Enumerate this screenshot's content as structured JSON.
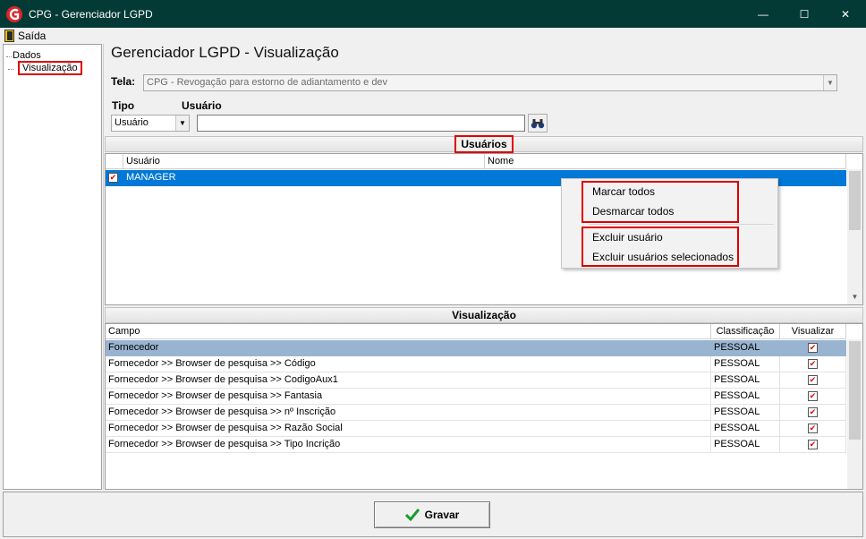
{
  "window": {
    "title": "CPG - Gerenciador LGPD",
    "controls": [
      "—",
      "☐",
      "✕"
    ]
  },
  "menu": {
    "exit_label": "Saída"
  },
  "tree": {
    "items": [
      {
        "label": "Dados"
      },
      {
        "label": "Visualização"
      }
    ]
  },
  "page": {
    "title": "Gerenciador LGPD - Visualização"
  },
  "form": {
    "screen_label": "Tela:",
    "screen_value": "CPG - Revogação para estorno de adiantamento e dev",
    "type_label": "Tipo",
    "type_value": "Usuário",
    "user_label": "Usuário",
    "user_value": ""
  },
  "users": {
    "header": "Usuários",
    "columns": [
      "Usuário",
      "Nome"
    ],
    "rows": [
      {
        "checked": true,
        "user": "MANAGER",
        "name": ""
      }
    ]
  },
  "context_menu": {
    "items": [
      "Marcar todos",
      "Desmarcar todos",
      "Excluir usuário",
      "Excluir usuários selecionados"
    ]
  },
  "view": {
    "header": "Visualização",
    "columns": [
      "Campo",
      "Classificação",
      "Visualizar"
    ],
    "rows": [
      {
        "field": "Fornecedor",
        "class": "PESSOAL",
        "checked": true
      },
      {
        "field": "Fornecedor >> Browser de pesquisa >> Código",
        "class": "PESSOAL",
        "checked": true
      },
      {
        "field": "Fornecedor >> Browser de pesquisa >> CodigoAux1",
        "class": "PESSOAL",
        "checked": true
      },
      {
        "field": "Fornecedor >> Browser de pesquisa >> Fantasia",
        "class": "PESSOAL",
        "checked": true
      },
      {
        "field": "Fornecedor >> Browser de pesquisa >> nº Inscrição",
        "class": "PESSOAL",
        "checked": true
      },
      {
        "field": "Fornecedor >> Browser de pesquisa >> Razão Social",
        "class": "PESSOAL",
        "checked": true
      },
      {
        "field": "Fornecedor >> Browser de pesquisa >> Tipo Incrição",
        "class": "PESSOAL",
        "checked": true
      }
    ]
  },
  "footer": {
    "save_label": "Gravar"
  },
  "colors": {
    "titlebar": "#033a36",
    "highlight": "#e00000",
    "selection": "#0078d7",
    "selection_light": "#99b4d1"
  }
}
